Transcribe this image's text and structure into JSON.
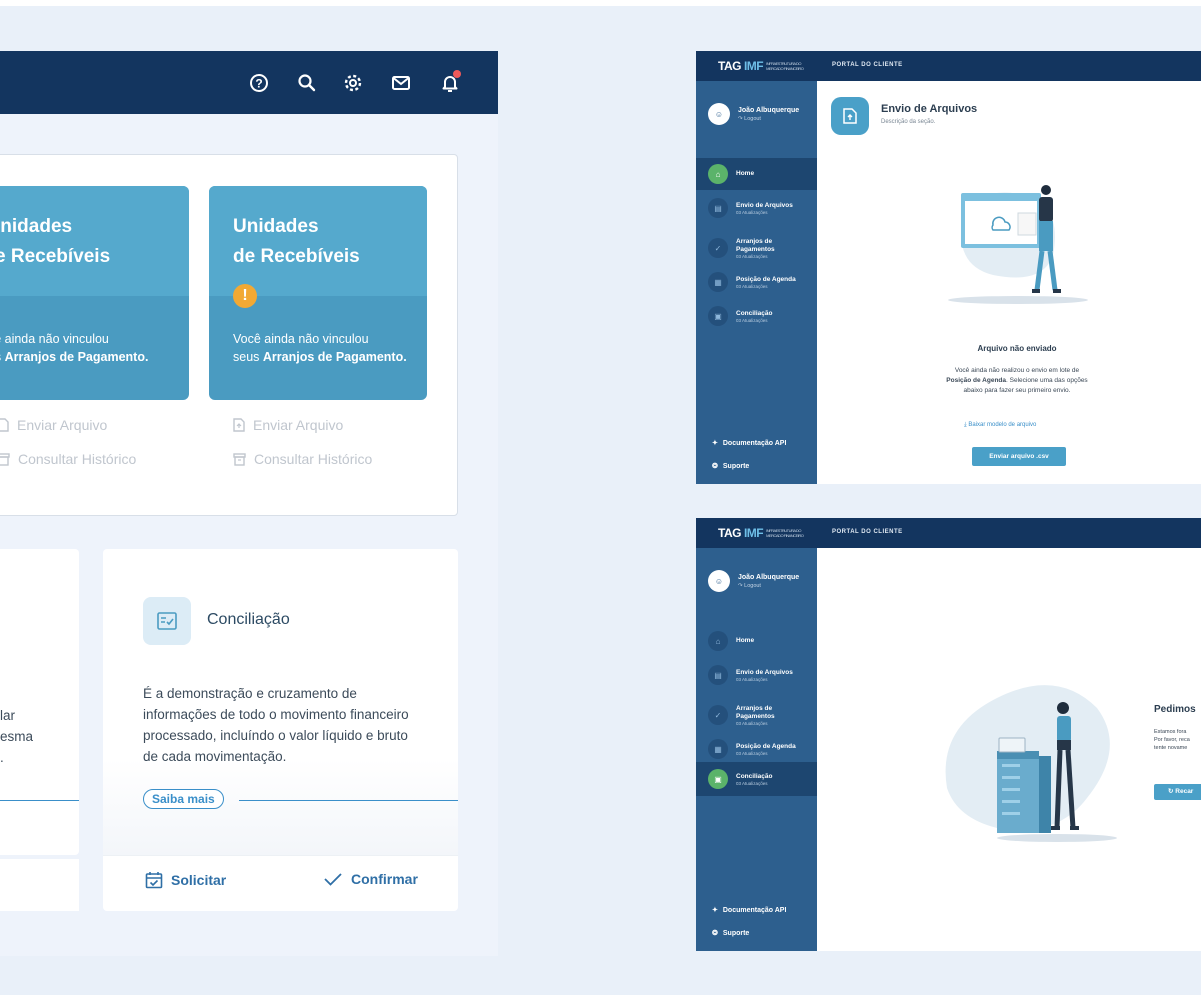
{
  "topbar": {
    "icons": [
      "help-icon",
      "search-icon",
      "gear-icon",
      "mail-icon",
      "bell-icon"
    ],
    "help_glyph": "?"
  },
  "units": [
    {
      "title_line1": "Unidades",
      "title_line2": "de Recebíveis",
      "text_line1": "Você ainda não vinculou",
      "text_line2_prefix": "seus ",
      "text_line2_bold": "Arranjos de Pagamento.",
      "left_text_line1": "ocê ainda não vinculou",
      "left_text_line2_prefix": "eus ",
      "left_title_line1": "Inidades",
      "left_title_line2": "e Recebíveis"
    }
  ],
  "card_links": {
    "send": "Enviar Arquivo",
    "history": "Consultar Histórico"
  },
  "left_card": {
    "line1": "lar",
    "line2": "esma",
    "line3": "."
  },
  "conciliacao": {
    "title": "Conciliação",
    "description": "É a demonstração e cruzamento de informações de todo o movimento financeiro processado, incluíndo o valor líquido e bruto de cada movimentação.",
    "saiba_mais": "Saiba mais",
    "solicitar": "Solicitar",
    "confirmar": "Confirmar"
  },
  "portal": {
    "logo_tag": "TAG",
    "logo_imf": "IMF",
    "logo_small": "INFRAESTRUTURA DO MERCADO FINANCEIRO",
    "header": "PORTAL DO CLIENTE",
    "user_name": "João Albuquerque",
    "logout": "Logout",
    "nav": [
      {
        "label": "Home",
        "sub": ""
      },
      {
        "label": "Envio de Arquivos",
        "sub": "03 Atualizações"
      },
      {
        "label": "Arranjos de Pagamentos",
        "sub": "03 Atualizações"
      },
      {
        "label": "Posição de Agenda",
        "sub": "03 Atualizações"
      },
      {
        "label": "Conciliação",
        "sub": "03 Atualizações"
      }
    ],
    "doc_api": "Documentação API",
    "suporte": "Suporte"
  },
  "screen1": {
    "title": "Envio de Arquivos",
    "subtitle": "Descrição da seção.",
    "status_title": "Arquivo não enviado",
    "msg_line1": "Você ainda não realizou o envio em lote de",
    "msg_line2_bold": "Posição de Agenda",
    "msg_line2_rest": ". Selecione uma das opções",
    "msg_line3": "abaixo para fazer seu primeiro envio.",
    "download_link": "Baixar modelo de arquivo",
    "send_button": "Enviar arquivo .csv"
  },
  "screen2": {
    "title": "Pedimos",
    "line1": "Estamos fora",
    "line2": "Por favor, reca",
    "line3": "tente novame",
    "button": "Recar"
  }
}
